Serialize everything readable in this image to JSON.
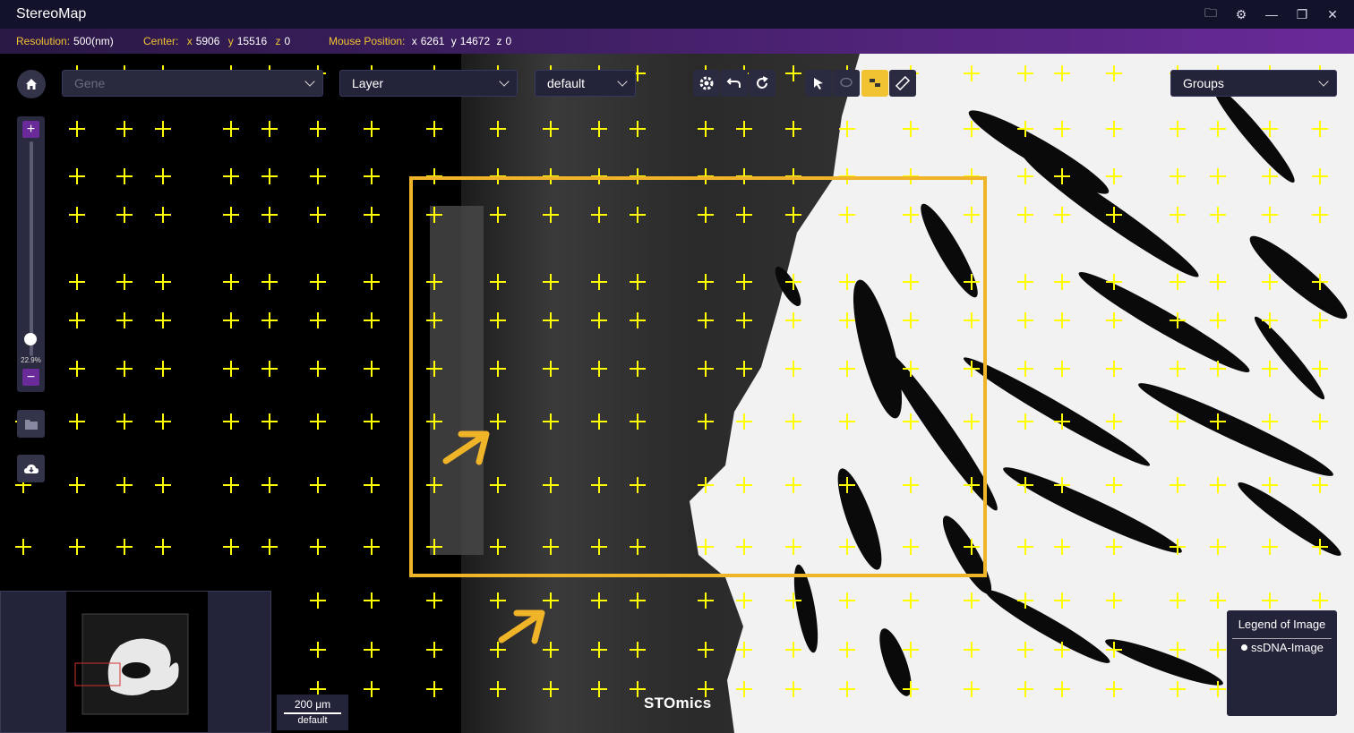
{
  "app": {
    "title": "StereoMap"
  },
  "window_buttons": [
    {
      "name": "open-folder-icon",
      "glyph": "🗀"
    },
    {
      "name": "settings-icon",
      "glyph": "⚙"
    },
    {
      "name": "minimize-icon",
      "glyph": "—"
    },
    {
      "name": "restore-icon",
      "glyph": "❐"
    },
    {
      "name": "close-icon",
      "glyph": "✕"
    }
  ],
  "status": {
    "resolution_label": "Resolution:",
    "resolution_value": "500(nm)",
    "center_label": "Center:",
    "center_x_label": "x",
    "center_x": "5906",
    "center_y_label": "y",
    "center_y": "15516",
    "center_z_label": "z",
    "center_z": "0",
    "mouse_label": "Mouse Position:",
    "mouse_x_label": "x",
    "mouse_x": "6261",
    "mouse_y_label": "y",
    "mouse_y": "14672",
    "mouse_z_label": "z",
    "mouse_z": "0"
  },
  "toolbar": {
    "gene_placeholder": "Gene",
    "layer_label": "Layer",
    "style_label": "default",
    "groups_label": "Groups"
  },
  "zoom": {
    "level": "22.9%",
    "fraction": 0.229
  },
  "scale": {
    "value": "200 μm",
    "mode": "default"
  },
  "watermark": "STOmics",
  "legend": {
    "title": "Legend of Image",
    "items": [
      "ssDNA-Image"
    ]
  },
  "colors": {
    "accent": "#f1c232",
    "purple": "#6a2a9a",
    "highlight_box": "#f0b429",
    "grid_cross": "#ffff00"
  }
}
